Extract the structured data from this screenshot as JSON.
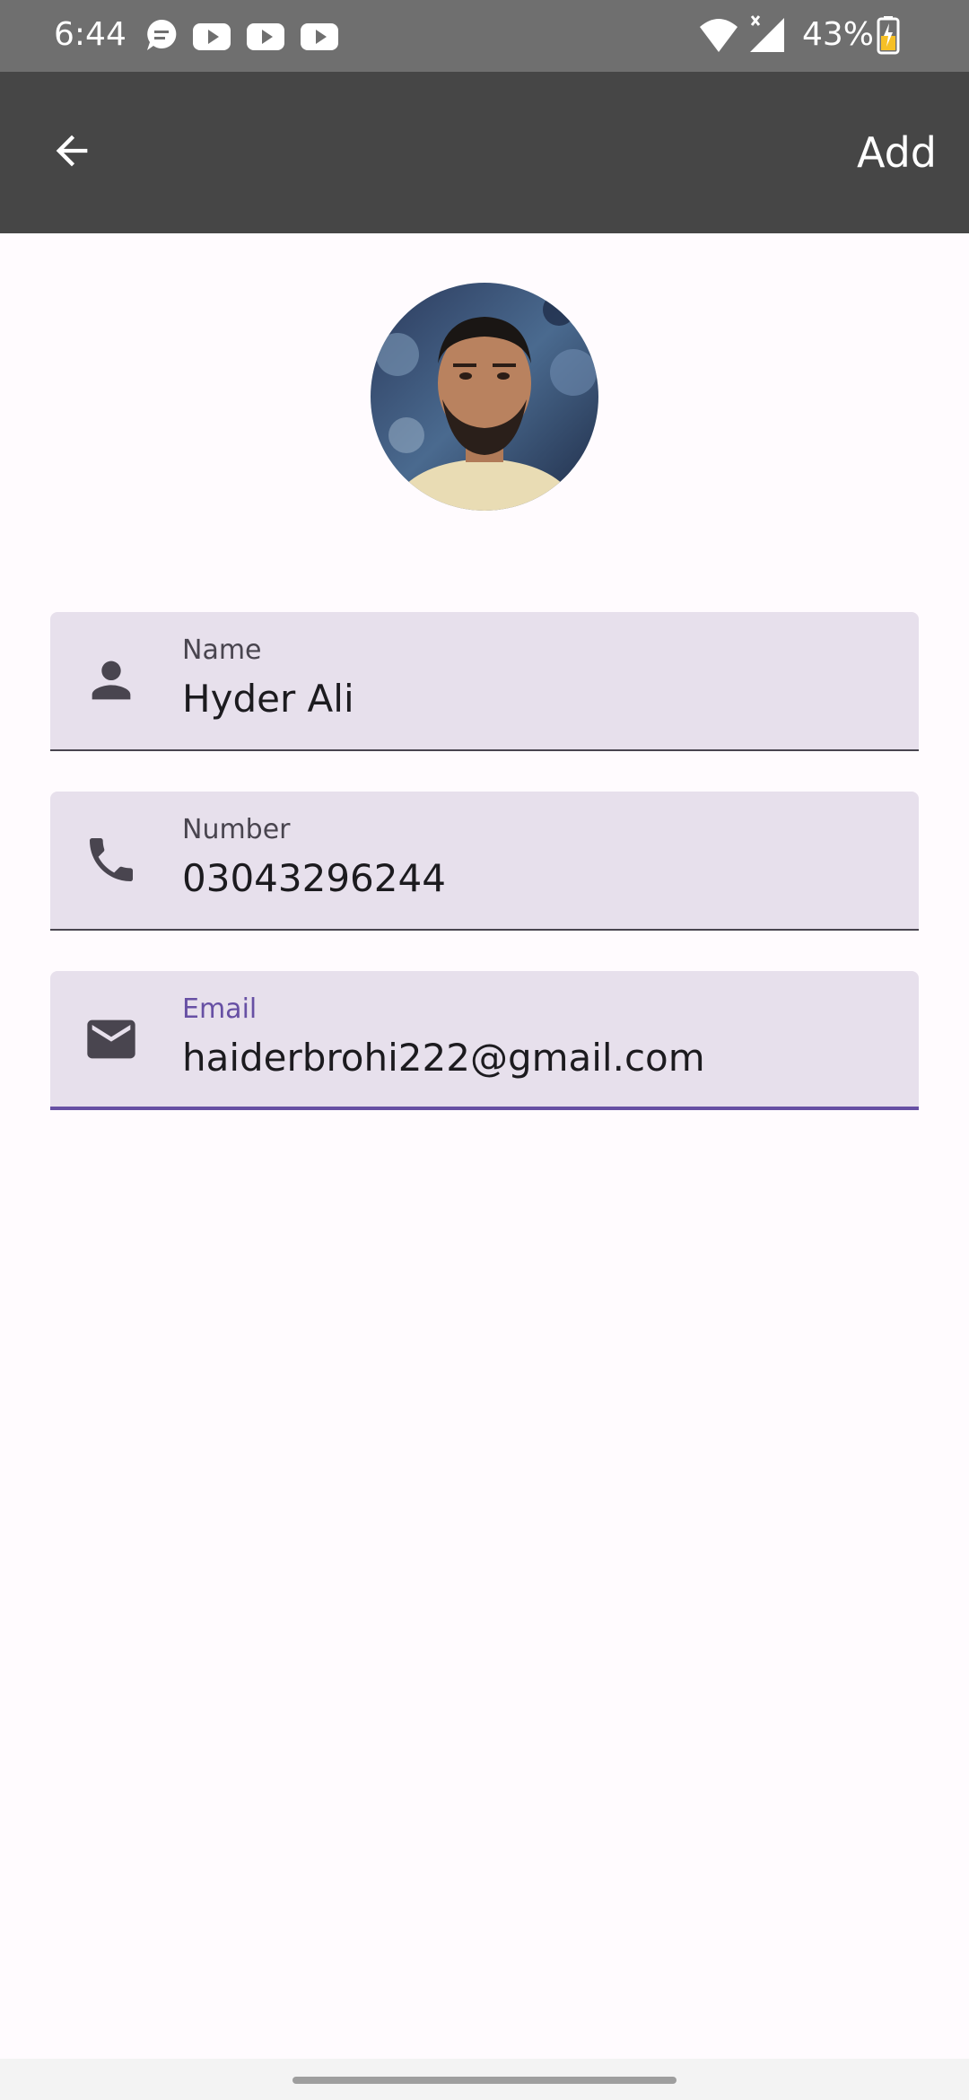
{
  "status_bar": {
    "time": "6:44",
    "battery_percent": "43%",
    "notification_icons": [
      "chat-icon",
      "youtube-icon",
      "youtube-icon",
      "youtube-icon"
    ],
    "system_icons": [
      "wifi-icon",
      "cell-signal-icon",
      "battery-charging-icon"
    ]
  },
  "app_bar": {
    "back_icon": "arrow-back-icon",
    "action_label": "Add"
  },
  "form": {
    "name": {
      "label": "Name",
      "value": "Hyder Ali",
      "icon": "person-icon"
    },
    "number": {
      "label": "Number",
      "value": "03043296244",
      "icon": "phone-icon"
    },
    "email": {
      "label": "Email",
      "value": "haiderbrohi222@gmail.com",
      "icon": "mail-icon"
    }
  },
  "colors": {
    "app_bar": "#464646",
    "status_bar": "#6f6f6f",
    "field_background": "#e7e0ec",
    "accent": "#6750a4",
    "page_background": "#fffbfe"
  }
}
